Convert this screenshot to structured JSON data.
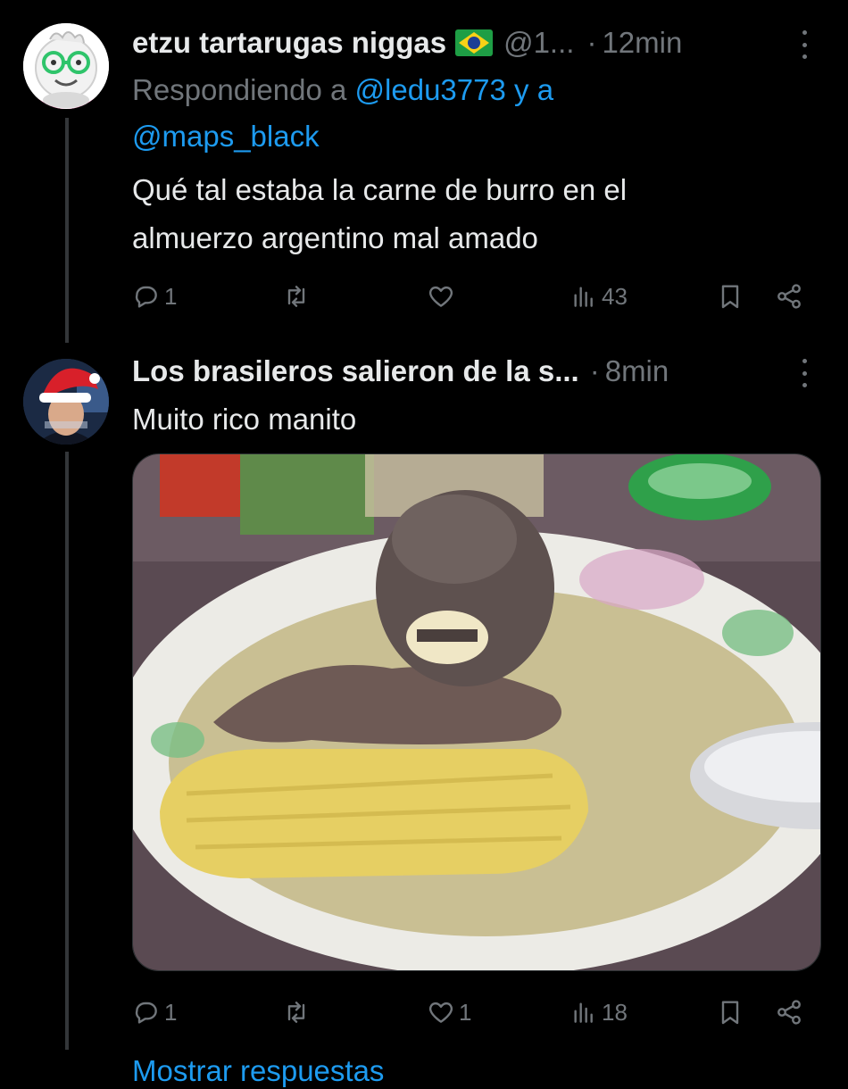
{
  "reply1": {
    "display_name": "etzu tartarugas niggas",
    "handle": "@1...",
    "separator": "·",
    "time": "12min",
    "replying_prefix": "Respondiendo a",
    "replying_user1": "@ledu3773",
    "replying_join": "y a",
    "replying_user2": "@maps_black",
    "text_line1": "Qué tal estaba la carne de burro en el",
    "text_line2": "almuerzo argentino mal amado",
    "counts": {
      "replies": "1",
      "reposts": "",
      "likes": "",
      "views": "43"
    }
  },
  "reply2": {
    "display_name": "Los brasileros salieron de la s...",
    "separator": "·",
    "time": "8min",
    "text": "Muito rico manito",
    "counts": {
      "replies": "1",
      "reposts": "",
      "likes": "1",
      "views": "18"
    }
  },
  "footer": {
    "show_replies": "Mostrar respuestas"
  },
  "colors": {
    "background": "#000000",
    "text": "#e7e9ea",
    "muted": "#71767b",
    "link": "#1d9bf0",
    "thread_line": "#333639"
  },
  "icons": [
    "reply-icon",
    "repost-icon",
    "like-icon",
    "views-icon",
    "bookmark-icon",
    "share-icon",
    "more-icon",
    "brazil-flag-icon"
  ]
}
